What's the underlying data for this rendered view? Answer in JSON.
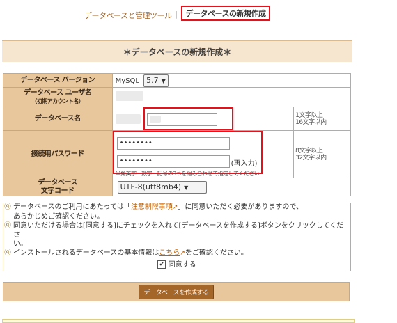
{
  "tabs": {
    "link_label": "データベースと管理ツール",
    "separator": "|",
    "active_label": "データベースの新規作成"
  },
  "section_title": "＊データベースの新規作成＊",
  "form": {
    "version": {
      "label": "データベース バージョン",
      "db_name": "MySQL",
      "selected": "5.7"
    },
    "user": {
      "label": "データベース ユーザ名",
      "sublabel": "（初期アカウント名）"
    },
    "dbname": {
      "label": "データベース名",
      "hint_line1": "1文字以上",
      "hint_line2": "16文字以内"
    },
    "password": {
      "label": "接続用パスワード",
      "value1": "••••••••",
      "value2": "••••••••",
      "reenter": "(再入力)",
      "note": "半角英字・数字・記号の3つを組み合わせて指定してください",
      "hint_line1": "8文字以上",
      "hint_line2": "32文字以内"
    },
    "charset": {
      "label_line1": "データベース",
      "label_line2": "文字コード",
      "selected": "UTF-8(utf8mb4)"
    }
  },
  "notes": {
    "note1_a": "データベースのご利用にあたっては「",
    "note1_link": "注意制限事項",
    "note1_b": "」に同意いただく必要がありますので、",
    "note1_c": "あらかじめご確認ください。",
    "note2_a": "同意いただける場合は[同意する]にチェックを入れて[データベースを作成する]ボタンをクリックしてくださ",
    "note2_b": "い。",
    "note3_a": "インストールされるデータベースの基本情報は",
    "note3_link": "こちら",
    "note3_b": "をご確認ください。"
  },
  "agree_label": "同意する",
  "submit_label": "データベースを作成する",
  "colors": {
    "accent_red": "#e8101a",
    "label_bg": "#e8c79d",
    "button_bg": "#a5662a"
  }
}
